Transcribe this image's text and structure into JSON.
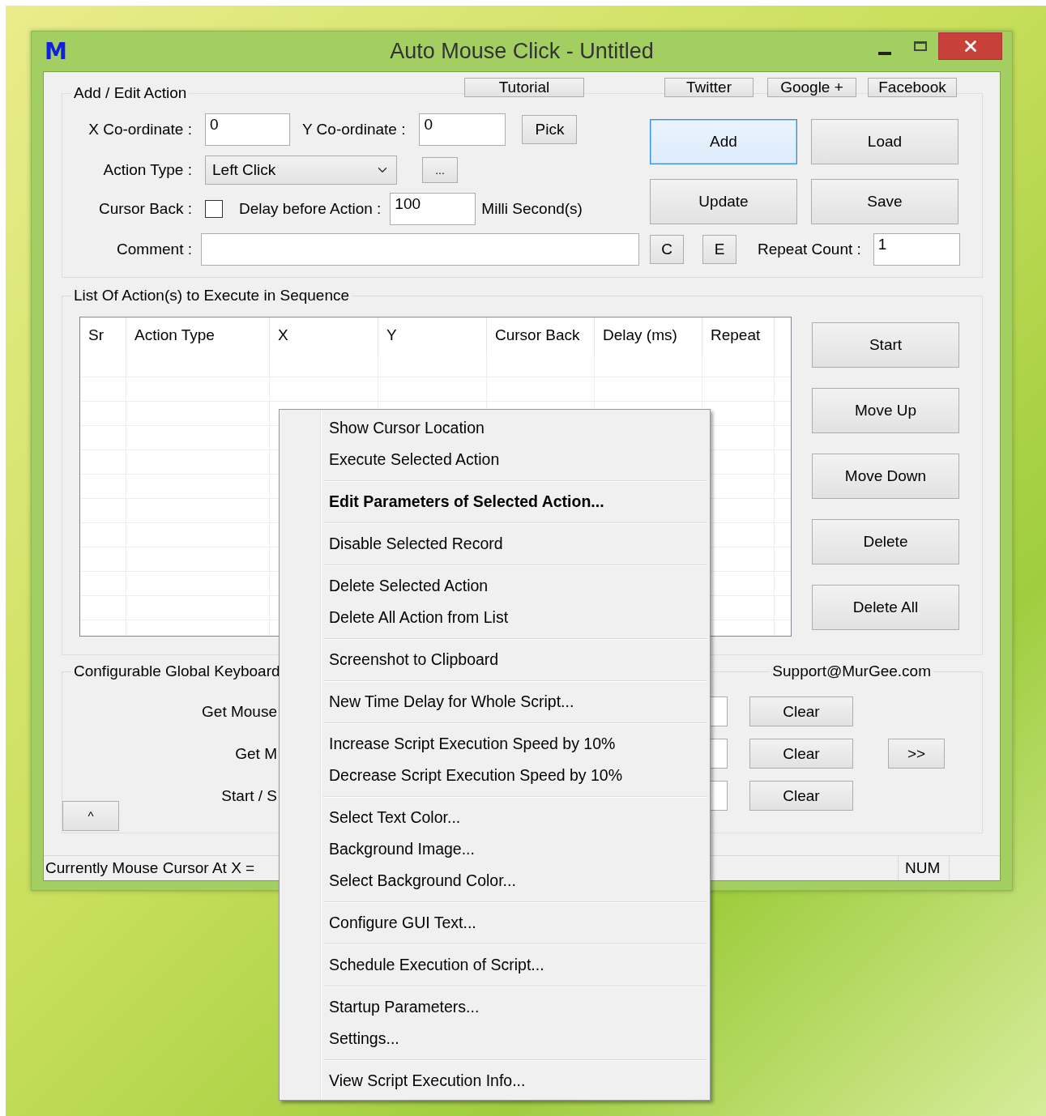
{
  "window": {
    "app_icon": "M",
    "title": "Auto Mouse Click - Untitled"
  },
  "tutorial_button": "Tutorial",
  "social_buttons": [
    "Twitter",
    "Google +",
    "Facebook"
  ],
  "add_edit": {
    "title": "Add / Edit Action",
    "x_label": "X Co-ordinate :",
    "x_value": "0",
    "y_label": "Y Co-ordinate :",
    "y_value": "0",
    "pick_button": "Pick",
    "action_type_label": "Action Type :",
    "action_type_value": "Left Click",
    "more_button": "...",
    "cursor_back_label": "Cursor Back :",
    "cursor_back_checked": false,
    "delay_label": "Delay before Action :",
    "delay_value": "100",
    "delay_unit": "Milli Second(s)",
    "comment_label": "Comment :",
    "c_button": "C",
    "e_button": "E",
    "repeat_label": "Repeat Count :",
    "repeat_value": "1",
    "buttons": [
      {
        "label": "Add",
        "focused": true
      },
      {
        "label": "Load",
        "focused": false
      },
      {
        "label": "Update",
        "focused": false
      },
      {
        "label": "Save",
        "focused": false
      }
    ]
  },
  "action_list": {
    "title": "List Of Action(s) to Execute in Sequence",
    "columns": [
      "Sr",
      "Action Type",
      "X",
      "Y",
      "Cursor Back",
      "Delay (ms)",
      "Repeat"
    ],
    "buttons": [
      "Start",
      "Move Up",
      "Move Down",
      "Delete",
      "Delete All"
    ]
  },
  "keyboard": {
    "title": "Configurable Global Keyboard",
    "support_link": "Support@MurGee.com",
    "rows": [
      {
        "label": "Get Mouse",
        "clear_button": "Clear"
      },
      {
        "label": "Get M",
        "clear_button": "Clear"
      },
      {
        "label": "Start / S",
        "clear_button": "Clear"
      }
    ],
    "more_button": ">>",
    "collapse_button": "^"
  },
  "status_bar": {
    "text": "Currently Mouse Cursor At X =",
    "indicator": "NUM"
  },
  "context_menu": {
    "groups": [
      [
        {
          "label": "Show Cursor Location",
          "default": false
        },
        {
          "label": "Execute Selected Action",
          "default": false
        }
      ],
      [
        {
          "label": "Edit Parameters of Selected Action...",
          "default": true
        }
      ],
      [
        {
          "label": "Disable Selected Record",
          "default": false
        }
      ],
      [
        {
          "label": "Delete Selected Action",
          "default": false
        },
        {
          "label": "Delete All Action from List",
          "default": false
        }
      ],
      [
        {
          "label": "Screenshot to Clipboard",
          "default": false
        }
      ],
      [
        {
          "label": "New Time Delay for Whole Script...",
          "default": false
        }
      ],
      [
        {
          "label": "Increase Script Execution Speed by 10%",
          "default": false
        },
        {
          "label": "Decrease Script Execution Speed by 10%",
          "default": false
        }
      ],
      [
        {
          "label": "Select Text Color...",
          "default": false
        },
        {
          "label": "Background Image...",
          "default": false
        },
        {
          "label": "Select Background Color...",
          "default": false
        }
      ],
      [
        {
          "label": "Configure GUI Text...",
          "default": false
        }
      ],
      [
        {
          "label": "Schedule Execution of Script...",
          "default": false
        }
      ],
      [
        {
          "label": "Startup Parameters...",
          "default": false
        },
        {
          "label": "Settings...",
          "default": false
        }
      ],
      [
        {
          "label": "View Script Execution Info...",
          "default": false
        }
      ]
    ]
  }
}
